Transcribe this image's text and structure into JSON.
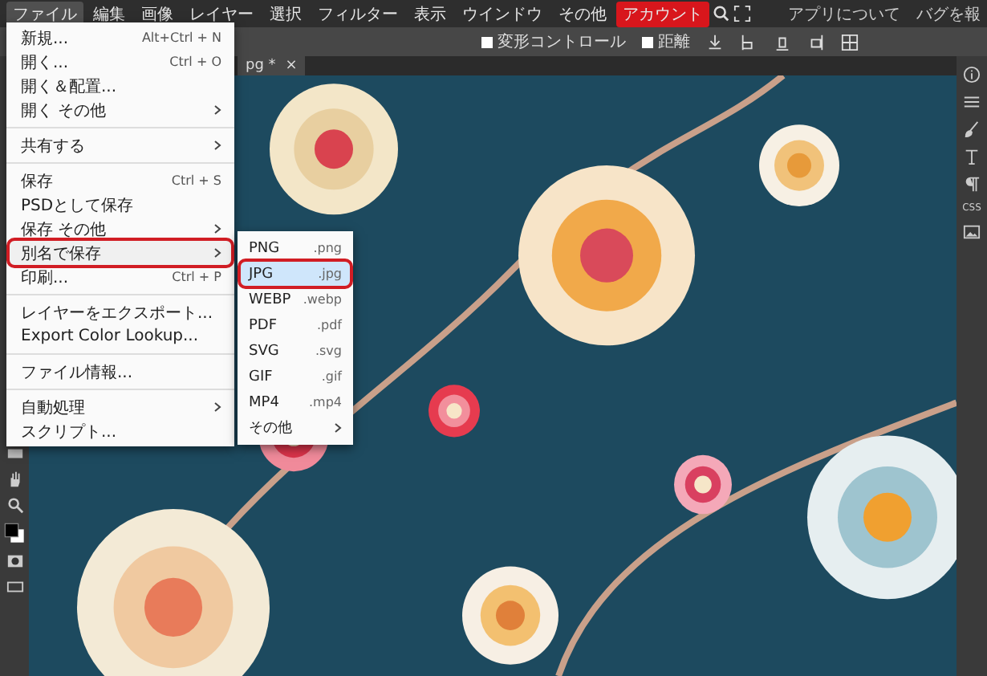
{
  "menu_bar": {
    "items": [
      {
        "label": "ファイル",
        "selected": true,
        "kind": "menu"
      },
      {
        "label": "編集",
        "selected": false,
        "kind": "menu"
      },
      {
        "label": "画像",
        "selected": false,
        "kind": "menu"
      },
      {
        "label": "レイヤー",
        "selected": false,
        "kind": "menu"
      },
      {
        "label": "選択",
        "selected": false,
        "kind": "menu"
      },
      {
        "label": "フィルター",
        "selected": false,
        "kind": "menu"
      },
      {
        "label": "表示",
        "selected": false,
        "kind": "menu"
      },
      {
        "label": "ウインドウ",
        "selected": false,
        "kind": "menu"
      },
      {
        "label": "その他",
        "selected": false,
        "kind": "menu"
      },
      {
        "label": "アカウント",
        "selected": false,
        "kind": "account"
      }
    ],
    "right_links": [
      "アプリについて",
      "バグを報"
    ]
  },
  "tool_options": {
    "checkboxes": [
      {
        "label": "変形コントロール",
        "checked": false
      },
      {
        "label": "距離",
        "checked": false
      }
    ]
  },
  "document_tab": {
    "title": "pg *",
    "close": "×"
  },
  "file_menu": {
    "items": [
      {
        "kind": "item",
        "label": "新規...",
        "shortcut": "Alt+Ctrl + N",
        "submenu": false,
        "highlighted": false
      },
      {
        "kind": "item",
        "label": "開く...",
        "shortcut": "Ctrl + O",
        "submenu": false,
        "highlighted": false
      },
      {
        "kind": "item",
        "label": "開く＆配置...",
        "submenu": false,
        "highlighted": false
      },
      {
        "kind": "item",
        "label": "開く その他",
        "submenu": true,
        "highlighted": false
      },
      {
        "kind": "divider"
      },
      {
        "kind": "item",
        "label": "共有する",
        "submenu": true,
        "highlighted": false
      },
      {
        "kind": "divider"
      },
      {
        "kind": "item",
        "label": "保存",
        "shortcut": "Ctrl + S",
        "submenu": false,
        "highlighted": false
      },
      {
        "kind": "item",
        "label": "PSDとして保存",
        "submenu": false,
        "highlighted": false
      },
      {
        "kind": "item",
        "label": "保存 その他",
        "submenu": true,
        "highlighted": false
      },
      {
        "kind": "item",
        "label": "別名で保存",
        "submenu": true,
        "highlighted": true
      },
      {
        "kind": "item",
        "label": "印刷...",
        "shortcut": "Ctrl + P",
        "submenu": false,
        "highlighted": false
      },
      {
        "kind": "divider"
      },
      {
        "kind": "item",
        "label": "レイヤーをエクスポート...",
        "submenu": false,
        "highlighted": false
      },
      {
        "kind": "item",
        "label": "Export Color Lookup...",
        "submenu": false,
        "highlighted": false
      },
      {
        "kind": "divider"
      },
      {
        "kind": "item",
        "label": "ファイル情報...",
        "submenu": false,
        "highlighted": false
      },
      {
        "kind": "divider"
      },
      {
        "kind": "item",
        "label": "自動処理",
        "submenu": true,
        "highlighted": false
      },
      {
        "kind": "item",
        "label": "スクリプト...",
        "submenu": false,
        "highlighted": false
      }
    ]
  },
  "save_as_menu": {
    "items": [
      {
        "label": "PNG",
        "ext": ".png",
        "selected": false,
        "submenu": false
      },
      {
        "label": "JPG",
        "ext": ".jpg",
        "selected": true,
        "submenu": false
      },
      {
        "label": "WEBP",
        "ext": ".webp",
        "selected": false,
        "submenu": false
      },
      {
        "label": "PDF",
        "ext": ".pdf",
        "selected": false,
        "submenu": false
      },
      {
        "label": "SVG",
        "ext": ".svg",
        "selected": false,
        "submenu": false
      },
      {
        "label": "GIF",
        "ext": ".gif",
        "selected": false,
        "submenu": false
      },
      {
        "label": "MP4",
        "ext": ".mp4",
        "selected": false,
        "submenu": false
      },
      {
        "label": "その他",
        "selected": false,
        "submenu": true
      }
    ]
  },
  "right_panel": {
    "css_label": "CSS"
  }
}
